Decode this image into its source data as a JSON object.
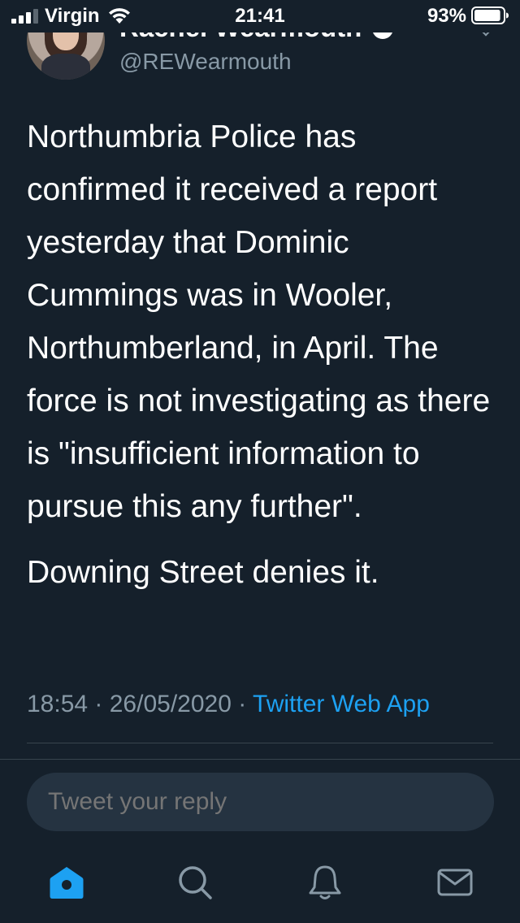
{
  "status_bar": {
    "carrier": "Virgin",
    "time": "21:41",
    "battery_percent": "93%",
    "battery_level": 0.93,
    "icons": [
      "signal-icon",
      "wifi-icon",
      "battery-icon"
    ]
  },
  "tweet": {
    "author": {
      "display_name": "Rachel Wearmouth",
      "handle": "@REWearmouth",
      "verified": true
    },
    "paragraphs": [
      "Northumbria Police has confirmed it received a report yesterday that Dominic Cummings was in Wooler, Northumberland, in April. The force is not investigating as there is \"insufficient information to pursue this any further\".",
      "Downing Street denies it."
    ],
    "meta": {
      "time": "18:54",
      "separator": " · ",
      "date": "26/05/2020",
      "source": "Twitter Web App"
    }
  },
  "reply": {
    "placeholder": "Tweet your reply"
  },
  "tab_bar": {
    "tabs": [
      {
        "name": "home",
        "icon": "home-icon",
        "active": true
      },
      {
        "name": "search",
        "icon": "search-icon",
        "active": false
      },
      {
        "name": "notifications",
        "icon": "bell-icon",
        "active": false
      },
      {
        "name": "messages",
        "icon": "mail-icon",
        "active": false
      }
    ]
  },
  "colors": {
    "background": "#15202b",
    "text": "#ffffff",
    "secondary_text": "#8899a6",
    "accent": "#1da1f2",
    "divider": "#38444d",
    "reply_box": "#253341"
  }
}
